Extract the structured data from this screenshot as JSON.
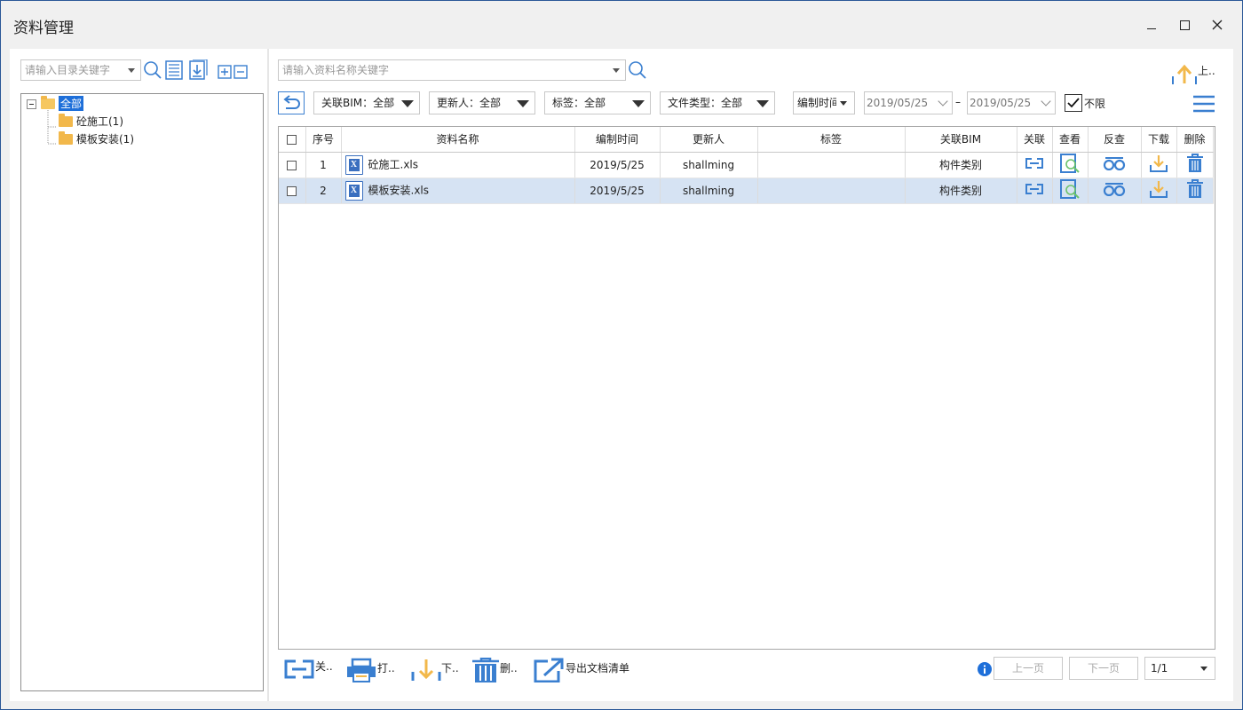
{
  "window": {
    "title": "资料管理",
    "minimize_glyph": "–",
    "maximize_glyph": "☐",
    "close_glyph": "✕"
  },
  "left": {
    "search_placeholder": "请输入目录关键字",
    "tree": [
      {
        "label": "全部",
        "selected": true
      },
      {
        "label": "砼施工(1)"
      },
      {
        "label": "模板安装(1)"
      }
    ]
  },
  "right": {
    "search_placeholder": "请输入资料名称关键字",
    "upload_label": "上..",
    "filters": {
      "bim": "关联BIM：全部",
      "updater": "更新人：全部",
      "tag": "标签：全部",
      "filetype": "文件类型：全部",
      "time_field": "编制时间",
      "date_from": "2019/05/25",
      "date_sep": "–",
      "date_to": "2019/05/25",
      "unlimited_label": "不限"
    },
    "table": {
      "headers": [
        "序号",
        "资料名称",
        "编制时间",
        "更新人",
        "标签",
        "关联BIM",
        "关联",
        "查看",
        "反查",
        "下载",
        "删除"
      ],
      "rows": [
        {
          "no": "1",
          "name": "砼施工.xls",
          "date": "2019/5/25",
          "updater": "shallming",
          "tag": "",
          "bim": "构件类别"
        },
        {
          "no": "2",
          "name": "模板安装.xls",
          "date": "2019/5/25",
          "updater": "shallming",
          "tag": "",
          "bim": "构件类别"
        }
      ]
    },
    "bottom": {
      "link_label": "关..",
      "print_label": "打..",
      "download_label": "下..",
      "delete_label": "删..",
      "export_label": "导出文档清单",
      "prev_page": "上一页",
      "next_page": "下一页",
      "page_indicator": "1/1"
    }
  },
  "colors": {
    "accent_blue": "#3a7fd0",
    "orange": "#f2b84b",
    "selection": "#d6e3f3"
  }
}
